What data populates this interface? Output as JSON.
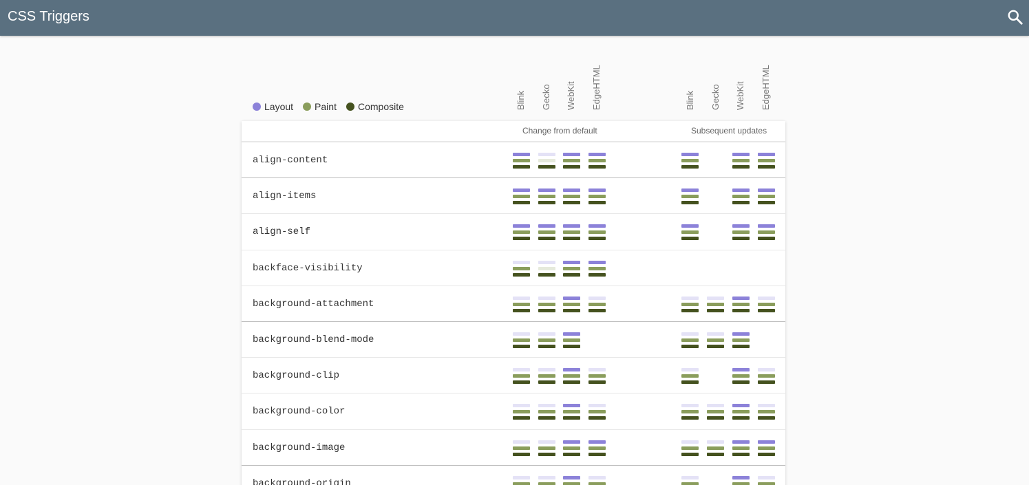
{
  "header": {
    "title": "CSS Triggers",
    "search_icon": "search-icon"
  },
  "legend": [
    {
      "label": "Layout",
      "color": "#8c82d9"
    },
    {
      "label": "Paint",
      "color": "#8a9d5c"
    },
    {
      "label": "Composite",
      "color": "#45521f"
    }
  ],
  "engines": [
    "Blink",
    "Gecko",
    "WebKit",
    "EdgeHTML"
  ],
  "groups": [
    "Change from default",
    "Subsequent updates"
  ],
  "colors": {
    "layout_on": "#8c82d9",
    "layout_off": "#e4e2f6",
    "paint_on": "#8a9d5c",
    "paint_off": "#e6eadc",
    "composite_on": "#45521f",
    "composite_off": "#dfe3d2"
  },
  "rows": [
    {
      "name": "align-content",
      "section_start": false,
      "default": [
        [
          1,
          1,
          1
        ],
        [
          0,
          0,
          1
        ],
        [
          1,
          1,
          1
        ],
        [
          1,
          1,
          1
        ]
      ],
      "subsequent": [
        [
          1,
          1,
          1
        ],
        null,
        [
          1,
          1,
          1
        ],
        [
          1,
          1,
          1
        ]
      ]
    },
    {
      "name": "align-items",
      "section_start": true,
      "default": [
        [
          1,
          1,
          1
        ],
        [
          1,
          1,
          1
        ],
        [
          1,
          1,
          1
        ],
        [
          1,
          1,
          1
        ]
      ],
      "subsequent": [
        [
          1,
          1,
          1
        ],
        null,
        [
          1,
          1,
          1
        ],
        [
          1,
          1,
          1
        ]
      ]
    },
    {
      "name": "align-self",
      "section_start": false,
      "default": [
        [
          1,
          1,
          1
        ],
        [
          1,
          1,
          1
        ],
        [
          1,
          1,
          1
        ],
        [
          1,
          1,
          1
        ]
      ],
      "subsequent": [
        [
          1,
          1,
          1
        ],
        null,
        [
          1,
          1,
          1
        ],
        [
          1,
          1,
          1
        ]
      ]
    },
    {
      "name": "backface-visibility",
      "section_start": false,
      "default": [
        [
          0,
          1,
          1
        ],
        [
          0,
          0,
          1
        ],
        [
          1,
          1,
          1
        ],
        [
          1,
          1,
          1
        ]
      ],
      "subsequent": [
        null,
        null,
        null,
        null
      ]
    },
    {
      "name": "background-attachment",
      "section_start": false,
      "default": [
        [
          0,
          1,
          1
        ],
        [
          0,
          1,
          1
        ],
        [
          1,
          1,
          1
        ],
        [
          0,
          1,
          1
        ]
      ],
      "subsequent": [
        [
          0,
          1,
          1
        ],
        [
          0,
          1,
          1
        ],
        [
          1,
          1,
          1
        ],
        [
          0,
          1,
          1
        ]
      ]
    },
    {
      "name": "background-blend-mode",
      "section_start": true,
      "default": [
        [
          0,
          1,
          1
        ],
        [
          0,
          1,
          1
        ],
        [
          1,
          1,
          1
        ],
        null
      ],
      "subsequent": [
        [
          0,
          1,
          1
        ],
        [
          0,
          1,
          1
        ],
        [
          1,
          1,
          1
        ],
        null
      ]
    },
    {
      "name": "background-clip",
      "section_start": false,
      "default": [
        [
          0,
          1,
          1
        ],
        [
          0,
          1,
          1
        ],
        [
          1,
          1,
          1
        ],
        [
          0,
          1,
          1
        ]
      ],
      "subsequent": [
        [
          0,
          1,
          1
        ],
        null,
        [
          1,
          1,
          1
        ],
        [
          0,
          1,
          1
        ]
      ]
    },
    {
      "name": "background-color",
      "section_start": false,
      "default": [
        [
          0,
          1,
          1
        ],
        [
          0,
          1,
          1
        ],
        [
          1,
          1,
          1
        ],
        [
          0,
          1,
          1
        ]
      ],
      "subsequent": [
        [
          0,
          1,
          1
        ],
        [
          0,
          1,
          1
        ],
        [
          1,
          1,
          1
        ],
        [
          0,
          1,
          1
        ]
      ]
    },
    {
      "name": "background-image",
      "section_start": false,
      "default": [
        [
          0,
          1,
          1
        ],
        [
          0,
          1,
          1
        ],
        [
          1,
          1,
          1
        ],
        [
          1,
          1,
          1
        ]
      ],
      "subsequent": [
        [
          0,
          1,
          1
        ],
        [
          0,
          1,
          1
        ],
        [
          1,
          1,
          1
        ],
        [
          1,
          1,
          1
        ]
      ]
    },
    {
      "name": "background-origin",
      "section_start": true,
      "default": [
        [
          0,
          1,
          1
        ],
        [
          0,
          1,
          1
        ],
        [
          1,
          1,
          1
        ],
        [
          0,
          1,
          1
        ]
      ],
      "subsequent": [
        [
          0,
          1,
          1
        ],
        null,
        [
          1,
          1,
          1
        ],
        [
          0,
          1,
          1
        ]
      ]
    }
  ]
}
